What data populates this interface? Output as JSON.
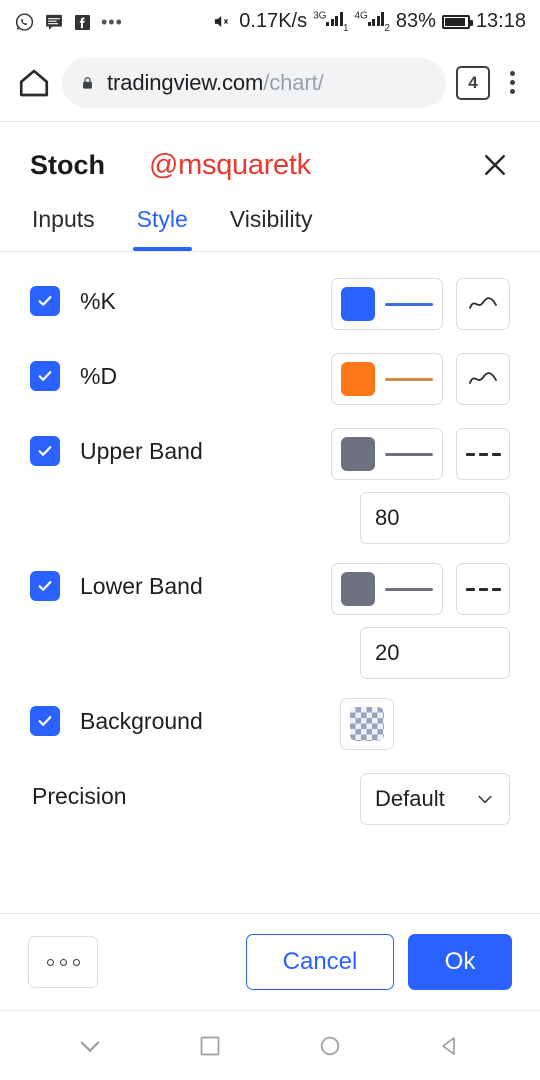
{
  "status_bar": {
    "app_icons": [
      "whatsapp-icon",
      "message-icon",
      "facebook-icon",
      "more-icon"
    ],
    "network_speed": "0.17K/s",
    "sim1_network": "3G",
    "sim1_index": "1",
    "sim2_network": "4G",
    "sim2_index": "2",
    "battery_percent": "83%",
    "time": "13:18"
  },
  "browser": {
    "home_icon": "home-icon",
    "lock_icon": "lock-icon",
    "url_domain": "tradingview.com",
    "url_path": "/chart/",
    "tab_count": "4",
    "menu_icon": "kebab-menu-icon"
  },
  "dialog": {
    "title": "Stoch",
    "username": "@msquaretk",
    "username_color": "#e8392f",
    "close_icon": "close-icon",
    "tabs": [
      {
        "label": "Inputs",
        "active": false
      },
      {
        "label": "Style",
        "active": true
      },
      {
        "label": "Visibility",
        "active": false
      }
    ],
    "accent_color": "#2962ff",
    "rows": [
      {
        "label": "%K",
        "checked": true,
        "color": "#2962ff",
        "line_color": "#3d6ce0",
        "line_style_icon": "wave-line-icon"
      },
      {
        "label": "%D",
        "checked": true,
        "color": "#ff7716",
        "line_color": "#cf8a3f",
        "line_style_icon": "wave-line-icon"
      },
      {
        "label": "Upper Band",
        "checked": true,
        "color": "#6d7180",
        "line_color": "#6d7180",
        "line_style_icon": "dashed-line-icon",
        "value": "80"
      },
      {
        "label": "Lower Band",
        "checked": true,
        "color": "#6d7180",
        "line_color": "#6d7180",
        "line_style_icon": "dashed-line-icon",
        "value": "20"
      },
      {
        "label": "Background",
        "checked": true,
        "swatch": "transparent-checker"
      }
    ],
    "precision": {
      "label": "Precision",
      "value": "Default",
      "chevron_icon": "chevron-down-icon"
    },
    "footer": {
      "more_label": "ooo",
      "cancel_label": "Cancel",
      "ok_label": "Ok"
    }
  },
  "nav_bar": {
    "items": [
      "chevron-down-icon",
      "recents-square-icon",
      "home-circle-icon",
      "back-triangle-icon"
    ]
  }
}
